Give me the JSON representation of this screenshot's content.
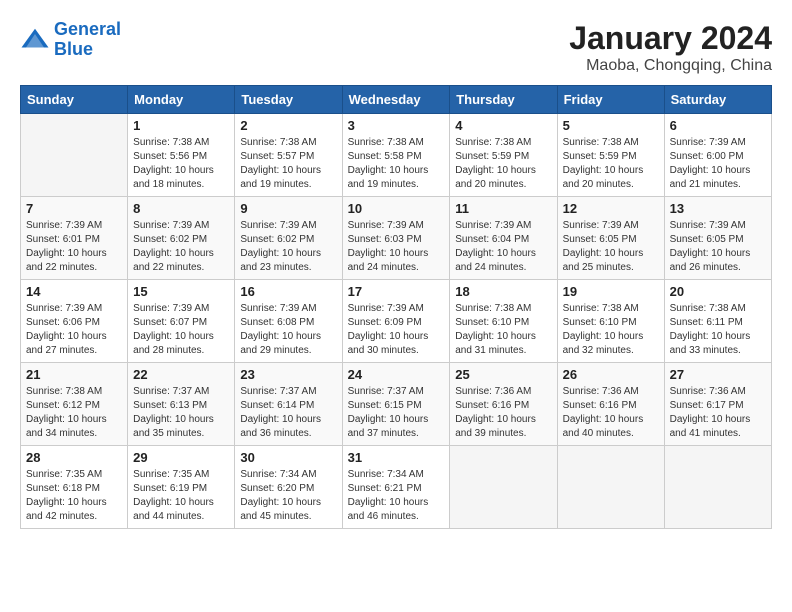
{
  "header": {
    "logo_line1": "General",
    "logo_line2": "Blue",
    "title": "January 2024",
    "subtitle": "Maoba, Chongqing, China"
  },
  "calendar": {
    "headers": [
      "Sunday",
      "Monday",
      "Tuesday",
      "Wednesday",
      "Thursday",
      "Friday",
      "Saturday"
    ],
    "weeks": [
      [
        {
          "day": "",
          "info": ""
        },
        {
          "day": "1",
          "info": "Sunrise: 7:38 AM\nSunset: 5:56 PM\nDaylight: 10 hours\nand 18 minutes."
        },
        {
          "day": "2",
          "info": "Sunrise: 7:38 AM\nSunset: 5:57 PM\nDaylight: 10 hours\nand 19 minutes."
        },
        {
          "day": "3",
          "info": "Sunrise: 7:38 AM\nSunset: 5:58 PM\nDaylight: 10 hours\nand 19 minutes."
        },
        {
          "day": "4",
          "info": "Sunrise: 7:38 AM\nSunset: 5:59 PM\nDaylight: 10 hours\nand 20 minutes."
        },
        {
          "day": "5",
          "info": "Sunrise: 7:38 AM\nSunset: 5:59 PM\nDaylight: 10 hours\nand 20 minutes."
        },
        {
          "day": "6",
          "info": "Sunrise: 7:39 AM\nSunset: 6:00 PM\nDaylight: 10 hours\nand 21 minutes."
        }
      ],
      [
        {
          "day": "7",
          "info": "Sunrise: 7:39 AM\nSunset: 6:01 PM\nDaylight: 10 hours\nand 22 minutes."
        },
        {
          "day": "8",
          "info": "Sunrise: 7:39 AM\nSunset: 6:02 PM\nDaylight: 10 hours\nand 22 minutes."
        },
        {
          "day": "9",
          "info": "Sunrise: 7:39 AM\nSunset: 6:02 PM\nDaylight: 10 hours\nand 23 minutes."
        },
        {
          "day": "10",
          "info": "Sunrise: 7:39 AM\nSunset: 6:03 PM\nDaylight: 10 hours\nand 24 minutes."
        },
        {
          "day": "11",
          "info": "Sunrise: 7:39 AM\nSunset: 6:04 PM\nDaylight: 10 hours\nand 24 minutes."
        },
        {
          "day": "12",
          "info": "Sunrise: 7:39 AM\nSunset: 6:05 PM\nDaylight: 10 hours\nand 25 minutes."
        },
        {
          "day": "13",
          "info": "Sunrise: 7:39 AM\nSunset: 6:05 PM\nDaylight: 10 hours\nand 26 minutes."
        }
      ],
      [
        {
          "day": "14",
          "info": "Sunrise: 7:39 AM\nSunset: 6:06 PM\nDaylight: 10 hours\nand 27 minutes."
        },
        {
          "day": "15",
          "info": "Sunrise: 7:39 AM\nSunset: 6:07 PM\nDaylight: 10 hours\nand 28 minutes."
        },
        {
          "day": "16",
          "info": "Sunrise: 7:39 AM\nSunset: 6:08 PM\nDaylight: 10 hours\nand 29 minutes."
        },
        {
          "day": "17",
          "info": "Sunrise: 7:39 AM\nSunset: 6:09 PM\nDaylight: 10 hours\nand 30 minutes."
        },
        {
          "day": "18",
          "info": "Sunrise: 7:38 AM\nSunset: 6:10 PM\nDaylight: 10 hours\nand 31 minutes."
        },
        {
          "day": "19",
          "info": "Sunrise: 7:38 AM\nSunset: 6:10 PM\nDaylight: 10 hours\nand 32 minutes."
        },
        {
          "day": "20",
          "info": "Sunrise: 7:38 AM\nSunset: 6:11 PM\nDaylight: 10 hours\nand 33 minutes."
        }
      ],
      [
        {
          "day": "21",
          "info": "Sunrise: 7:38 AM\nSunset: 6:12 PM\nDaylight: 10 hours\nand 34 minutes."
        },
        {
          "day": "22",
          "info": "Sunrise: 7:37 AM\nSunset: 6:13 PM\nDaylight: 10 hours\nand 35 minutes."
        },
        {
          "day": "23",
          "info": "Sunrise: 7:37 AM\nSunset: 6:14 PM\nDaylight: 10 hours\nand 36 minutes."
        },
        {
          "day": "24",
          "info": "Sunrise: 7:37 AM\nSunset: 6:15 PM\nDaylight: 10 hours\nand 37 minutes."
        },
        {
          "day": "25",
          "info": "Sunrise: 7:36 AM\nSunset: 6:16 PM\nDaylight: 10 hours\nand 39 minutes."
        },
        {
          "day": "26",
          "info": "Sunrise: 7:36 AM\nSunset: 6:16 PM\nDaylight: 10 hours\nand 40 minutes."
        },
        {
          "day": "27",
          "info": "Sunrise: 7:36 AM\nSunset: 6:17 PM\nDaylight: 10 hours\nand 41 minutes."
        }
      ],
      [
        {
          "day": "28",
          "info": "Sunrise: 7:35 AM\nSunset: 6:18 PM\nDaylight: 10 hours\nand 42 minutes."
        },
        {
          "day": "29",
          "info": "Sunrise: 7:35 AM\nSunset: 6:19 PM\nDaylight: 10 hours\nand 44 minutes."
        },
        {
          "day": "30",
          "info": "Sunrise: 7:34 AM\nSunset: 6:20 PM\nDaylight: 10 hours\nand 45 minutes."
        },
        {
          "day": "31",
          "info": "Sunrise: 7:34 AM\nSunset: 6:21 PM\nDaylight: 10 hours\nand 46 minutes."
        },
        {
          "day": "",
          "info": ""
        },
        {
          "day": "",
          "info": ""
        },
        {
          "day": "",
          "info": ""
        }
      ]
    ]
  }
}
